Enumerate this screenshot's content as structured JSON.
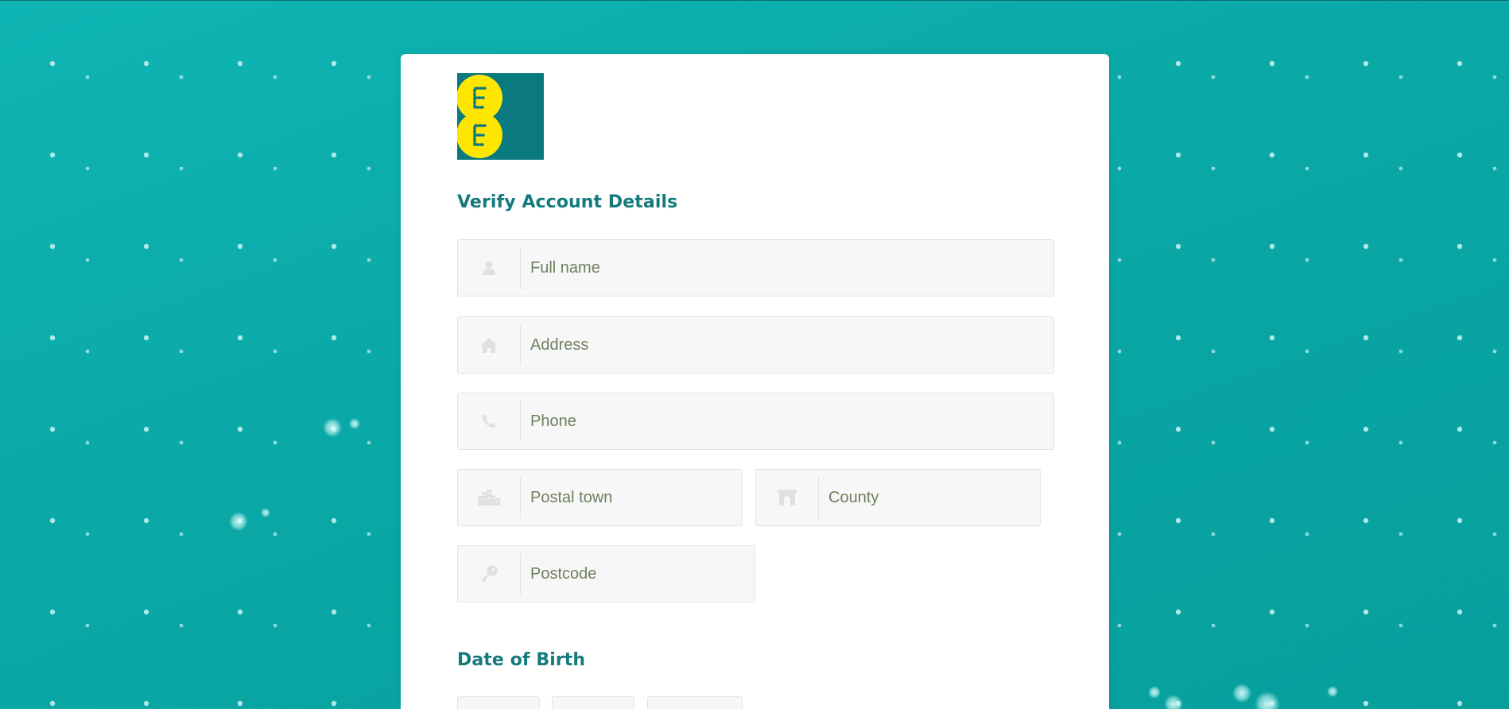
{
  "brand": {
    "logo_letters": "EE",
    "logo_bg_color": "#0a7a80",
    "logo_circle_color": "#ffe600"
  },
  "colors": {
    "background": "#0aa8a6",
    "heading": "#147a7c",
    "input_bg": "#f7f7f7",
    "placeholder": "#6f7f5e"
  },
  "form": {
    "title": "Verify Account Details",
    "fields": {
      "full_name": {
        "placeholder": "Full name",
        "value": "",
        "icon": "user-icon"
      },
      "address": {
        "placeholder": "Address",
        "value": "",
        "icon": "home-icon"
      },
      "phone": {
        "placeholder": "Phone",
        "value": "",
        "icon": "phone-icon"
      },
      "postal_town": {
        "placeholder": "Postal town",
        "value": "",
        "icon": "city-icon"
      },
      "county": {
        "placeholder": "County",
        "value": "",
        "icon": "archway-icon"
      },
      "postcode": {
        "placeholder": "Postcode",
        "value": "",
        "icon": "key-icon"
      }
    },
    "dob": {
      "title": "Date of Birth",
      "selects": [
        "day",
        "month",
        "year"
      ]
    }
  }
}
